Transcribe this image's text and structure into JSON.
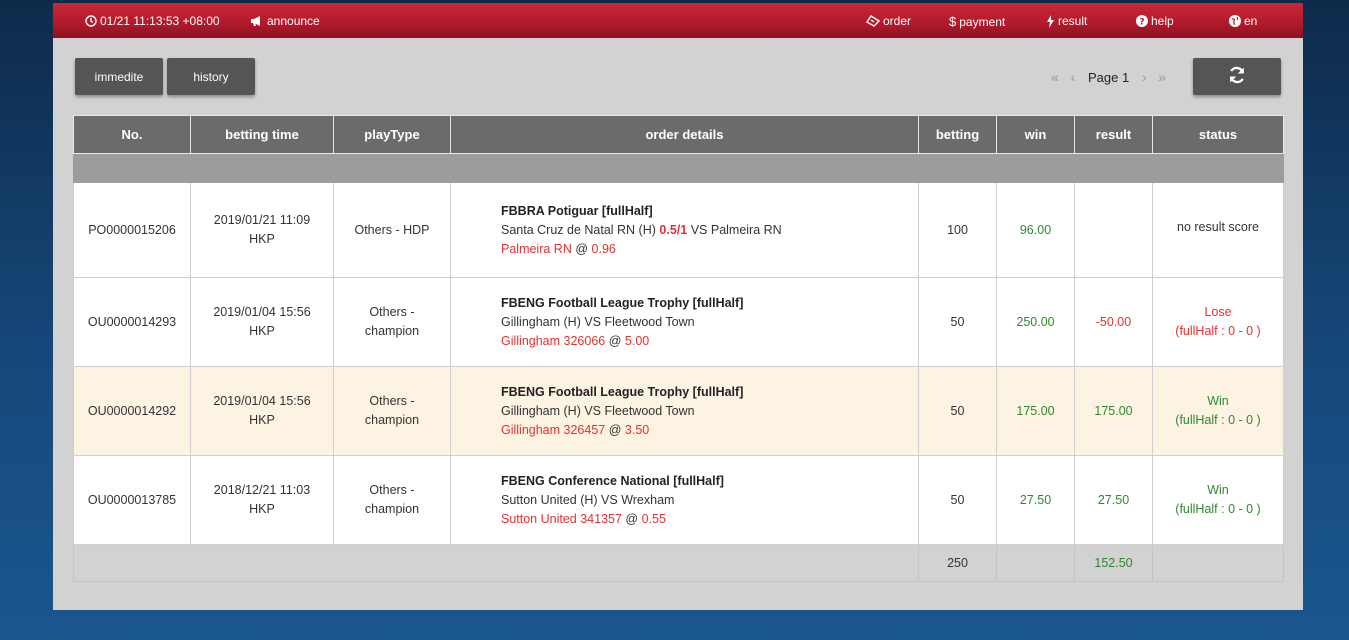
{
  "topbar": {
    "datetime": "01/21 11:13:53 +08:00",
    "announce": "announce",
    "order": "order",
    "payment": "payment",
    "result": "result",
    "help": "help",
    "lang": "en"
  },
  "buttons": {
    "immediate": "immedite",
    "history": "history"
  },
  "pager": {
    "first": "«",
    "prev": "‹",
    "label": "Page 1",
    "next": "›",
    "last": "»"
  },
  "table": {
    "headers": {
      "no": "No.",
      "betting_time": "betting time",
      "play_type": "playType",
      "order_details": "order details",
      "betting": "betting",
      "win": "win",
      "result": "result",
      "status": "status"
    },
    "rows": [
      {
        "no": "PO0000015206",
        "time": "2019/01/21 11:09",
        "tz": "HKP",
        "play1": "Others - HDP",
        "play2": "",
        "league": "FBBRA Potiguar [fullHalf]",
        "home": "Santa Cruz de Natal RN (H)",
        "handicap": "0.5/1",
        "vs": "VS Palmeira RN",
        "pick": "Palmeira RN",
        "at": "@",
        "odds": "0.96",
        "betting": "100",
        "win": "96.00",
        "result": "",
        "status1": "no result score",
        "status2": ""
      },
      {
        "no": "OU0000014293",
        "time": "2019/01/04 15:56",
        "tz": "HKP",
        "play1": "Others -",
        "play2": "champion",
        "league": "FBENG Football League Trophy [fullHalf]",
        "home": "Gillingham (H) VS Fleetwood Town",
        "pick": "Gillingham 326066",
        "at": "@",
        "odds": "5.00",
        "betting": "50",
        "win": "250.00",
        "result": "-50.00",
        "status1": "Lose",
        "status2": "(fullHalf : 0 - 0 )"
      },
      {
        "no": "OU0000014292",
        "time": "2019/01/04 15:56",
        "tz": "HKP",
        "play1": "Others -",
        "play2": "champion",
        "league": "FBENG Football League Trophy [fullHalf]",
        "home": "Gillingham (H) VS Fleetwood Town",
        "pick": "Gillingham 326457",
        "at": "@",
        "odds": "3.50",
        "betting": "50",
        "win": "175.00",
        "result": "175.00",
        "status1": "Win",
        "status2": "(fullHalf : 0 - 0 )"
      },
      {
        "no": "OU0000013785",
        "time": "2018/12/21 11:03",
        "tz": "HKP",
        "play1": "Others -",
        "play2": "champion",
        "league": "FBENG Conference National [fullHalf]",
        "home": "Sutton United (H) VS Wrexham",
        "pick": "Sutton United 341357",
        "at": "@",
        "odds": "0.55",
        "betting": "50",
        "win": "27.50",
        "result": "27.50",
        "status1": "Win",
        "status2": "(fullHalf : 0 - 0 )"
      }
    ],
    "totals": {
      "betting": "250",
      "result": "152.50"
    }
  },
  "colors": {
    "topbar": "#b01a2c",
    "loss": "#e5312f",
    "win": "#2f8a2f",
    "highlight_row": "#fdf3e3"
  }
}
